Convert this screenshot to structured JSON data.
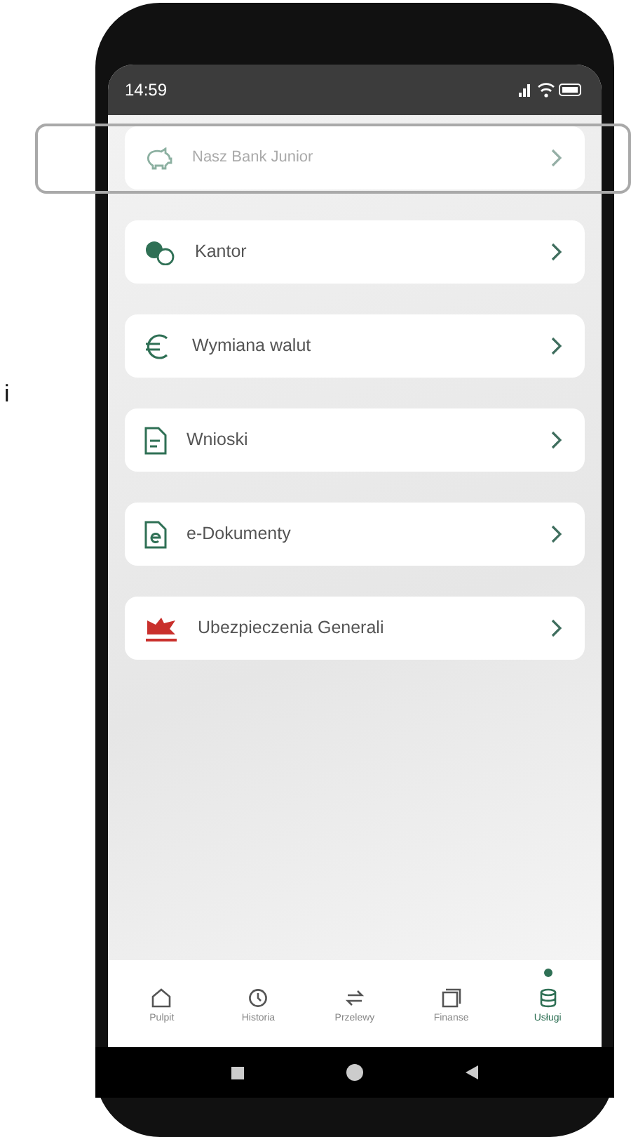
{
  "side_text": "i",
  "status_bar": {
    "time": "14:59"
  },
  "menu": [
    {
      "label": "Nasz Bank Junior",
      "highlighted": true
    },
    {
      "label": "Kantor",
      "highlighted": false
    },
    {
      "label": "Wymiana walut",
      "highlighted": false
    },
    {
      "label": "Wnioski",
      "highlighted": false
    },
    {
      "label": "e-Dokumenty",
      "highlighted": false
    },
    {
      "label": "Ubezpieczenia Generali",
      "highlighted": false
    }
  ],
  "bottom_nav": [
    {
      "label": "Pulpit",
      "selected": false
    },
    {
      "label": "Historia",
      "selected": false
    },
    {
      "label": "Przelewy",
      "selected": false
    },
    {
      "label": "Finanse",
      "selected": false
    },
    {
      "label": "Usługi",
      "selected": true
    }
  ]
}
